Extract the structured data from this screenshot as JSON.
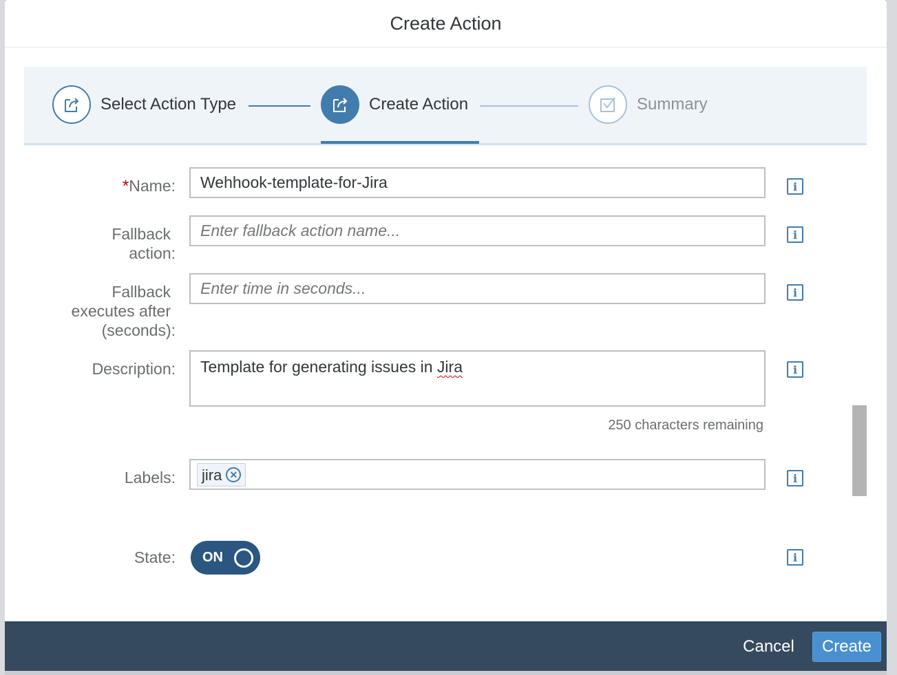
{
  "dialog": {
    "title": "Create Action"
  },
  "wizard": {
    "steps": [
      {
        "label": "Select Action Type",
        "state": "completed",
        "icon": "share-icon"
      },
      {
        "label": "Create Action",
        "state": "active",
        "icon": "share-icon"
      },
      {
        "label": "Summary",
        "state": "disabled",
        "icon": "checkbox-check-icon"
      }
    ]
  },
  "form": {
    "name": {
      "label": "Name:",
      "required_mark": "*",
      "value": "Wehhook-template-for-Jira"
    },
    "fallback_action": {
      "label_line1": "Fallback",
      "label_line2": "action:",
      "placeholder": "Enter fallback action name..."
    },
    "fallback_after": {
      "label_line1": "Fallback",
      "label_line2": "executes after",
      "label_line3": "(seconds):",
      "placeholder": "Enter time in seconds..."
    },
    "description": {
      "label": "Description:",
      "value_prefix": "Template for generating issues in ",
      "value_misspelled": "Jira",
      "counter": "250 characters remaining"
    },
    "labels": {
      "label": "Labels:",
      "tokens": [
        "jira"
      ]
    },
    "state": {
      "label": "State:",
      "toggle_text": "ON"
    },
    "info_icon": "i"
  },
  "footer": {
    "cancel": "Cancel",
    "create": "Create"
  },
  "colors": {
    "accent": "#427cac",
    "footer_bg": "#354a5f",
    "primary_button": "#4a90d0",
    "toggle_on": "#2a5680",
    "required": "#bb0000"
  }
}
